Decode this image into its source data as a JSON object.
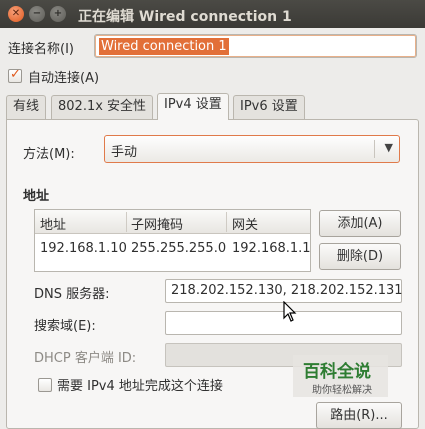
{
  "window": {
    "title": "正在编辑 Wired connection 1"
  },
  "connection_name": {
    "label": "连接名称(I)",
    "value": "Wired connection 1"
  },
  "auto_connect": {
    "label": "自动连接(A)",
    "checked": true
  },
  "tabs": [
    {
      "label": "有线",
      "active": false
    },
    {
      "label": "802.1x 安全性",
      "active": false
    },
    {
      "label": "IPv4 设置",
      "active": true
    },
    {
      "label": "IPv6 设置",
      "active": false
    }
  ],
  "ipv4": {
    "method_label": "方法(M):",
    "method_value": "手动",
    "address_section": "地址",
    "columns": [
      "地址",
      "子网掩码",
      "网关"
    ],
    "rows": [
      [
        "192.168.1.10",
        "255.255.255.0",
        "192.168.1.1"
      ]
    ],
    "add_button": "添加(A)",
    "delete_button": "删除(D)",
    "dns_label": "DNS 服务器:",
    "dns_value": "218.202.152.130, 218.202.152.131",
    "search_label": "搜索域(E):",
    "search_value": "",
    "dhcp_label": "DHCP 客户端 ID:",
    "dhcp_value": "",
    "require_label": "需要 IPv4 地址完成这个连接",
    "require_checked": false,
    "routes_button": "路由(R)..."
  },
  "watermark": {
    "title": "百科全说",
    "subtitle": "助你轻松解决"
  },
  "colors": {
    "accent": "#e0591e",
    "title_bar": "#3c3b37",
    "watermark": "#2e7d32"
  }
}
